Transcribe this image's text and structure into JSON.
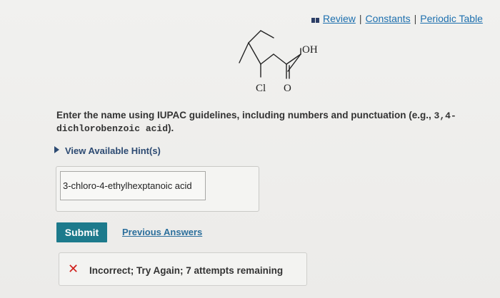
{
  "toplinks": {
    "review": "Review",
    "constants": "Constants",
    "periodic_table": "Periodic Table",
    "separator": "|"
  },
  "molecule": {
    "label_oh": "OH",
    "label_cl": "Cl",
    "label_o": "O"
  },
  "instructions": {
    "text": "Enter the name using IUPAC guidelines, including numbers and punctuation (e.g., ",
    "example": "3,4-dichlorobenzoic acid",
    "suffix": ")."
  },
  "hint": {
    "label": "View Available Hint(s)"
  },
  "answer": {
    "value": "3-chloro-4-ethylhexptanoic acid"
  },
  "actions": {
    "submit_label": "Submit",
    "previous_answers_label": "Previous Answers"
  },
  "feedback": {
    "message": "Incorrect; Try Again; 7 attempts remaining",
    "icon": "x-icon",
    "color": "#d0201c"
  },
  "colors": {
    "link": "#1c6fae",
    "submit": "#1d7a8c"
  }
}
